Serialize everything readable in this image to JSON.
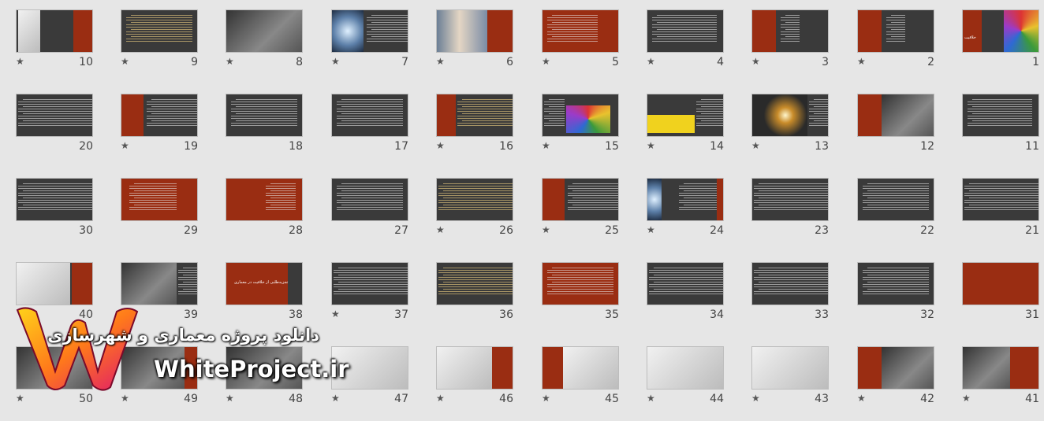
{
  "slides": [
    {
      "number": "1",
      "starred": false
    },
    {
      "number": "2",
      "starred": true
    },
    {
      "number": "3",
      "starred": true
    },
    {
      "number": "4",
      "starred": true
    },
    {
      "number": "5",
      "starred": true
    },
    {
      "number": "6",
      "starred": true
    },
    {
      "number": "7",
      "starred": true
    },
    {
      "number": "8",
      "starred": true
    },
    {
      "number": "9",
      "starred": true
    },
    {
      "number": "10",
      "starred": true
    },
    {
      "number": "11",
      "starred": false
    },
    {
      "number": "12",
      "starred": false
    },
    {
      "number": "13",
      "starred": true
    },
    {
      "number": "14",
      "starred": true
    },
    {
      "number": "15",
      "starred": true
    },
    {
      "number": "16",
      "starred": true
    },
    {
      "number": "17",
      "starred": false
    },
    {
      "number": "18",
      "starred": false
    },
    {
      "number": "19",
      "starred": true
    },
    {
      "number": "20",
      "starred": false
    },
    {
      "number": "21",
      "starred": false
    },
    {
      "number": "22",
      "starred": false
    },
    {
      "number": "23",
      "starred": false
    },
    {
      "number": "24",
      "starred": true
    },
    {
      "number": "25",
      "starred": true
    },
    {
      "number": "26",
      "starred": true
    },
    {
      "number": "27",
      "starred": false
    },
    {
      "number": "28",
      "starred": false
    },
    {
      "number": "29",
      "starred": false
    },
    {
      "number": "30",
      "starred": false
    },
    {
      "number": "31",
      "starred": false
    },
    {
      "number": "32",
      "starred": false
    },
    {
      "number": "33",
      "starred": false
    },
    {
      "number": "34",
      "starred": false
    },
    {
      "number": "35",
      "starred": false
    },
    {
      "number": "36",
      "starred": false
    },
    {
      "number": "37",
      "starred": true
    },
    {
      "number": "38",
      "starred": false
    },
    {
      "number": "39",
      "starred": false
    },
    {
      "number": "40",
      "starred": false
    },
    {
      "number": "41",
      "starred": true
    },
    {
      "number": "42",
      "starred": true
    },
    {
      "number": "43",
      "starred": true
    },
    {
      "number": "44",
      "starred": true
    },
    {
      "number": "45",
      "starred": true
    },
    {
      "number": "46",
      "starred": true
    },
    {
      "number": "47",
      "starred": true
    },
    {
      "number": "48",
      "starred": true
    },
    {
      "number": "49",
      "starred": true
    },
    {
      "number": "50",
      "starred": true
    }
  ],
  "star_glyph": "★",
  "slide_texts": {
    "s1": "خلاقیت",
    "s38": "تجزیه‌طلبی از خلاقیت در معماری"
  },
  "watermark": {
    "line1": "دانلود پروژه معماری و شهرسازی",
    "line2": "WhiteProject.ir"
  },
  "colors": {
    "background": "#e6e6e6",
    "slide_bg": "#3a3a3a",
    "accent": "#9a2d12"
  }
}
